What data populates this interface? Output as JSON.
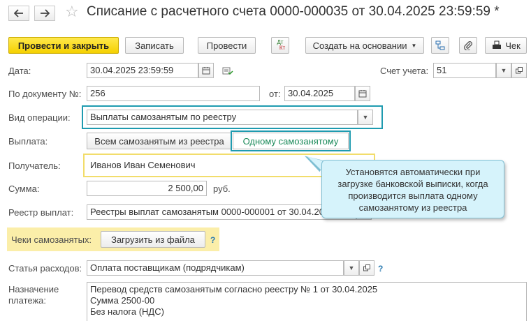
{
  "header": {
    "title": "Списание с расчетного счета 0000-000035 от 30.04.2025 23:59:59 *"
  },
  "toolbar": {
    "post_close": "Провести и закрыть",
    "save": "Записать",
    "post": "Провести",
    "dtkt_top": "Дт",
    "dtkt_bottom": "Кт",
    "create_based": "Создать на основании",
    "check": "Чек"
  },
  "form": {
    "date_label": "Дата:",
    "date_value": "30.04.2025 23:59:59",
    "account_label": "Счет учета:",
    "account_value": "51",
    "doc_label": "По документу №:",
    "doc_value": "256",
    "from_label": "от:",
    "from_value": "30.04.2025",
    "operation_label": "Вид операции:",
    "operation_value": "Выплаты самозанятым по реестру",
    "payment_label": "Выплата:",
    "payment_all": "Всем самозанятым из реестра",
    "payment_one": "Одному самозанятому",
    "recipient_label": "Получатель:",
    "recipient_value": "Иванов Иван Семенович",
    "amount_label": "Сумма:",
    "amount_value": "2 500,00",
    "amount_unit": "руб.",
    "registry_label": "Реестр выплат:",
    "registry_value": "Реестры выплат самозанятым 0000-000001 от 30.04.2025",
    "checks_label": "Чеки самозанятых:",
    "load_file": "Загрузить из файла",
    "help": "?",
    "expense_label": "Статья расходов:",
    "expense_value": "Оплата поставщикам (подрядчикам)",
    "purpose_label_1": "Назначение",
    "purpose_label_2": "платежа:",
    "purpose_text": "Перевод средств самозанятым согласно реестру № 1 от 30.04.2025\nСумма 2500-00\nБез налога (НДС)"
  },
  "callout": {
    "text": "Установятся автоматически при загрузке банковской выписки, когда производится выплата одному самозанятому из реестра"
  },
  "colors": {
    "primary": "#f5d000",
    "highlight": "#1f9bb0",
    "active_text": "#1b8a5a",
    "callout_bg": "#d6f3fb"
  }
}
